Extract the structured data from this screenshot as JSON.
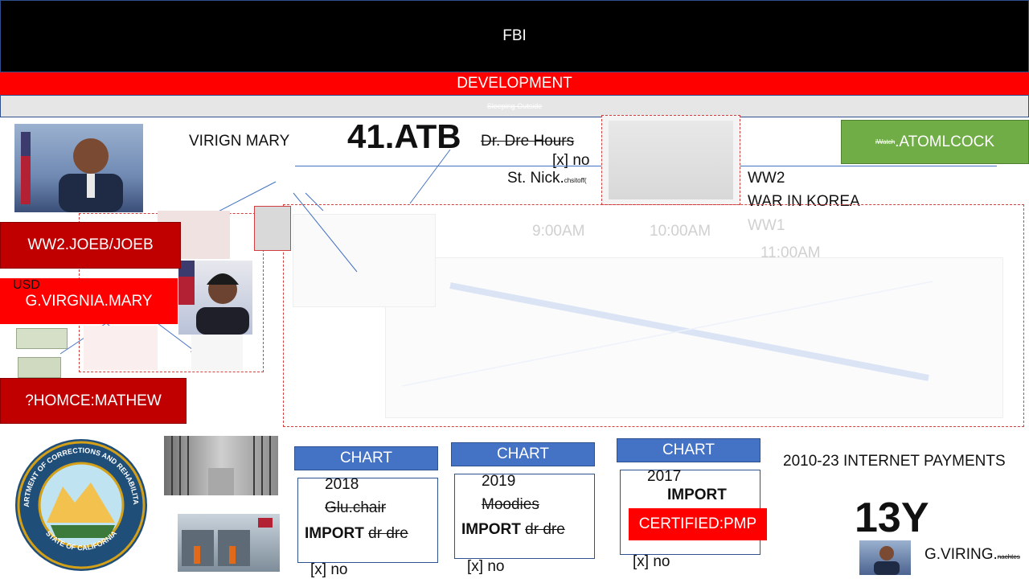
{
  "header": {
    "title": "FBI",
    "subtitle": "DEVELOPMENT",
    "ticker": "Sleeping Outside"
  },
  "top_labels": {
    "name": "VIRIGN MARY",
    "big_code": "41.ATB",
    "hours": "Dr. Dre Hours",
    "check_no": "[x] no",
    "st_nick": "St. Nick.",
    "st_nick_small": "chsitoff(",
    "green_small": "iWatch",
    "green_main": ".ATOMLCOCK"
  },
  "wars": [
    "WW2",
    "WAR IN KOREA",
    "WW1"
  ],
  "times": [
    "9:00AM",
    "10:00AM",
    "11:00AM"
  ],
  "left_buttons": {
    "joeb": "WW2.JOEB/JOEB",
    "usd": "USD",
    "mary": "G.VIRGNIA.MARY",
    "mathew": "?HOMCE:MATHEW"
  },
  "cards": [
    {
      "header": "CHART",
      "year": "2018",
      "struck": "Glu.chair",
      "import": "IMPORT",
      "import_struck": "dr dre",
      "check": "[x] no"
    },
    {
      "header": "CHART",
      "year": "2019",
      "struck": "Moodies",
      "import": "IMPORT",
      "import_struck": "dr dre",
      "check": "[x] no"
    },
    {
      "header": "CHART",
      "year": "2017",
      "import": "IMPORT",
      "certified": "CERTIFIED:PMP",
      "check": "[x] no"
    }
  ],
  "payments": {
    "label": "2010-23  INTERNET PAYMENTS",
    "big": "13Y",
    "footer_name": "G.VIRING.",
    "footer_small": "nachtes"
  },
  "seal": {
    "top_text": "DEPARTMENT OF CORRECTIONS AND REHABILITATION",
    "bottom_text": "STATE OF CALIFORNIA"
  },
  "colors": {
    "accent_red": "#ff0000",
    "dark_red": "#c00000",
    "blue": "#4472c4",
    "green": "#70ad47"
  }
}
